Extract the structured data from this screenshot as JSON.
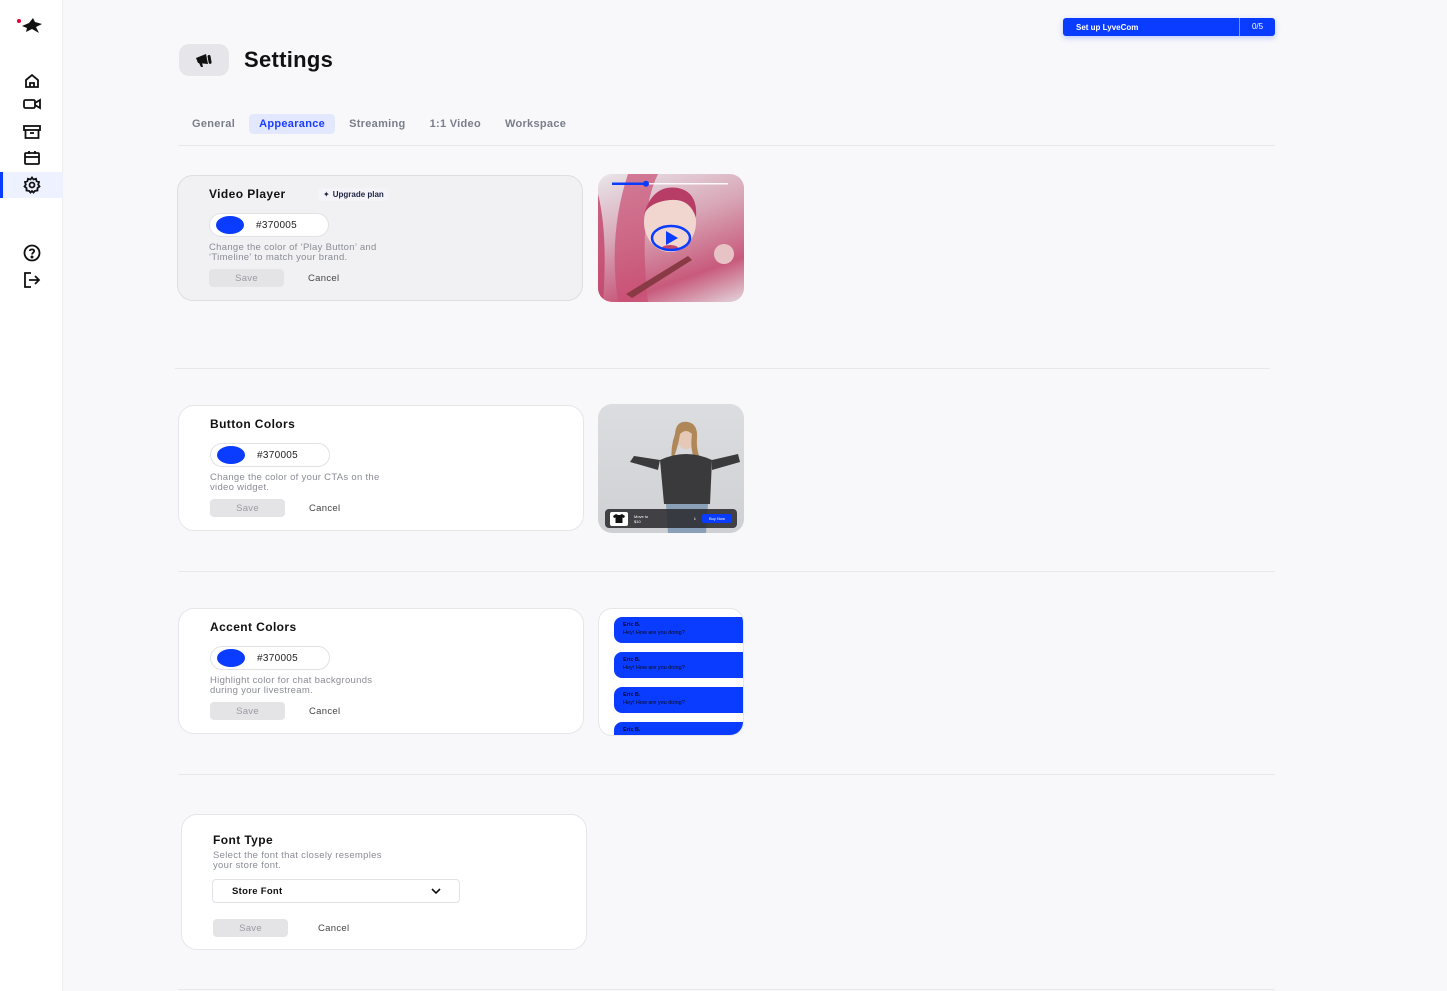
{
  "colors": {
    "accent": "#0a3cff"
  },
  "sidebar": {
    "items": [
      {
        "icon": "home-icon",
        "active": false
      },
      {
        "icon": "video-camera-icon",
        "active": false
      },
      {
        "icon": "archive-icon",
        "active": false
      },
      {
        "icon": "calendar-icon",
        "active": false
      },
      {
        "icon": "gear-icon",
        "active": true
      },
      {
        "icon": "help-icon",
        "active": false
      },
      {
        "icon": "logout-icon",
        "active": false
      }
    ]
  },
  "setup": {
    "label": "Set up LyveCom",
    "count": "0/5"
  },
  "header": {
    "icon": "megaphone-icon",
    "title": "Settings"
  },
  "tabs": [
    {
      "label": "General",
      "active": false
    },
    {
      "label": "Appearance",
      "active": true
    },
    {
      "label": "Streaming",
      "active": false
    },
    {
      "label": "1:1 Video",
      "active": false
    },
    {
      "label": "Workspace",
      "active": false
    }
  ],
  "video_player": {
    "title": "Video Player",
    "badge": "Upgrade plan",
    "hex": "#370005",
    "description": "Change the color of ‘Play Button’ and\n‘Timeline’ to match your brand.",
    "save": "Save",
    "cancel": "Cancel"
  },
  "button_colors": {
    "title": "Button Colors",
    "hex": "#370005",
    "description": "Change the color of your CTAs on the\nvideo widget.",
    "save": "Save",
    "cancel": "Cancel",
    "preview": {
      "product": "Move to\n$10",
      "price": "1",
      "cta": "Buy Now"
    }
  },
  "accent_colors": {
    "title": "Accent Colors",
    "hex": "#370005",
    "description": "Highlight color for chat backgrounds\nduring your livestream.",
    "save": "Save",
    "cancel": "Cancel",
    "chat": [
      {
        "name": "Eric B.",
        "message": "Hey! How are you doing?"
      },
      {
        "name": "Eric B.",
        "message": "Hey! How are you doing?"
      },
      {
        "name": "Eric B.",
        "message": "Hey! How are you doing?"
      },
      {
        "name": "Eric B.",
        "message": ""
      }
    ]
  },
  "font_type": {
    "title": "Font Type",
    "description": "Select the font that closely resemples\nyour store font.",
    "selected": "Store Font",
    "save": "Save",
    "cancel": "Cancel"
  }
}
